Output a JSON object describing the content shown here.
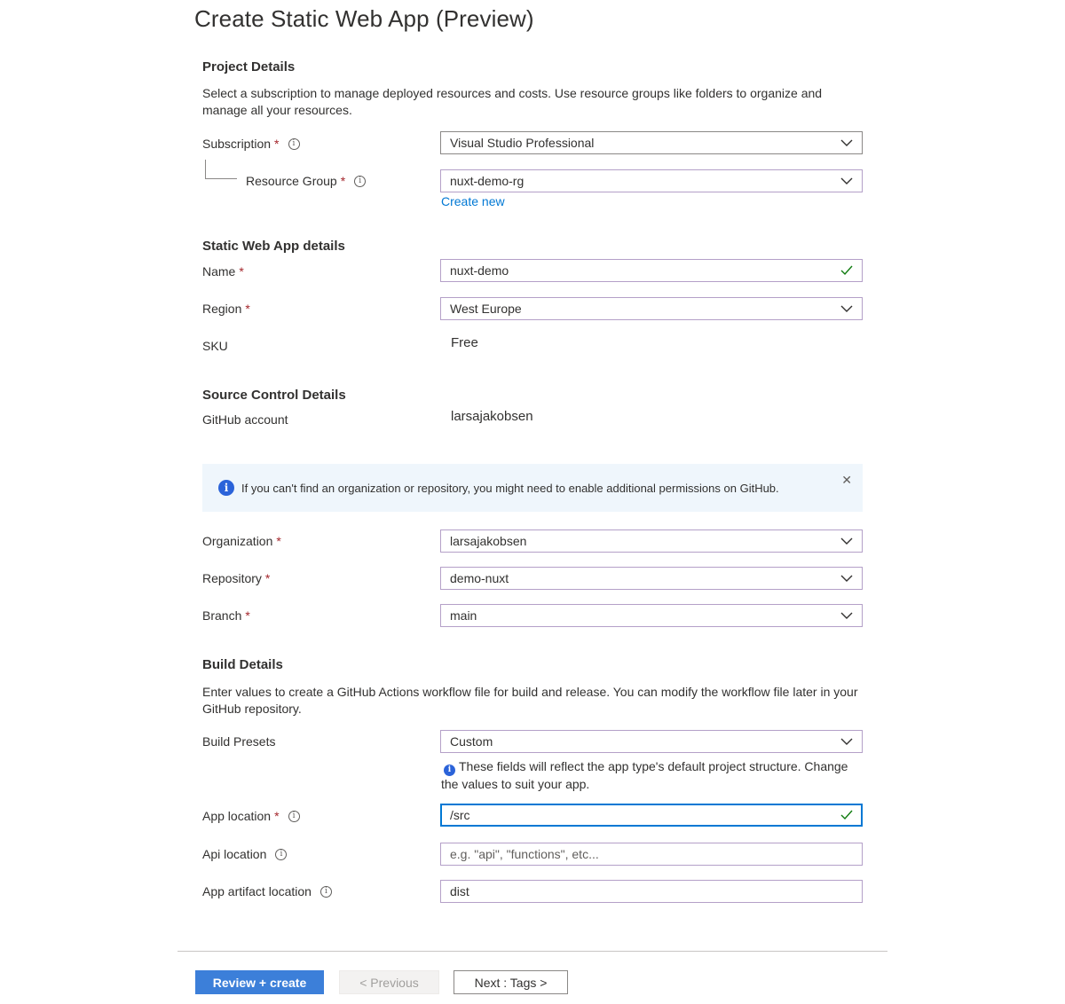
{
  "title": "Create Static Web App (Preview)",
  "project_details": {
    "heading": "Project Details",
    "description": "Select a subscription to manage deployed resources and costs. Use resource groups like folders to organize and manage all your resources.",
    "subscription_label": "Subscription",
    "subscription_value": "Visual Studio Professional",
    "resource_group_label": "Resource Group",
    "resource_group_value": "nuxt-demo-rg",
    "create_new": "Create new"
  },
  "app_details": {
    "heading": "Static Web App details",
    "name_label": "Name",
    "name_value": "nuxt-demo",
    "region_label": "Region",
    "region_value": "West Europe",
    "sku_label": "SKU",
    "sku_value": "Free"
  },
  "source_control": {
    "heading": "Source Control Details",
    "github_label": "GitHub account",
    "github_value": "larsajakobsen",
    "banner_text": "If you can't find an organization or repository, you might need to enable additional permissions on GitHub.",
    "organization_label": "Organization",
    "organization_value": "larsajakobsen",
    "repository_label": "Repository",
    "repository_value": "demo-nuxt",
    "branch_label": "Branch",
    "branch_value": "main"
  },
  "build_details": {
    "heading": "Build Details",
    "description": "Enter values to create a GitHub Actions workflow file for build and release. You can modify the workflow file later in your GitHub repository.",
    "presets_label": "Build Presets",
    "presets_value": "Custom",
    "presets_hint": "These fields will reflect the app type's default project structure. Change the values to suit your app.",
    "app_location_label": "App location",
    "app_location_value": "/src",
    "api_location_label": "Api location",
    "api_location_placeholder": "e.g. \"api\", \"functions\", etc...",
    "artifact_location_label": "App artifact location",
    "artifact_location_value": "dist"
  },
  "footer": {
    "review_create": "Review + create",
    "previous": "< Previous",
    "next": "Next : Tags >"
  },
  "colors": {
    "accent": "#0078d4",
    "required": "#a4262c",
    "success": "#107c10",
    "info": "#2b63d9"
  }
}
